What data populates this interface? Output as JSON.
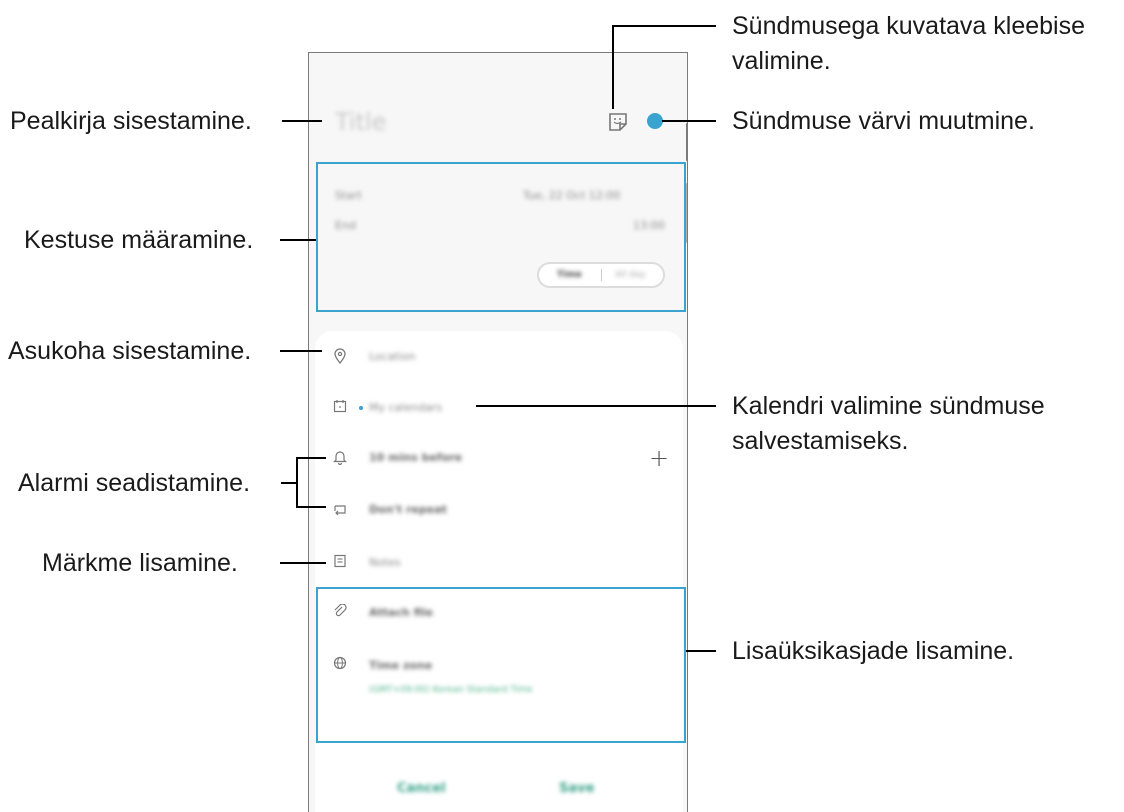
{
  "screen": {
    "title_placeholder": "Title",
    "start_label": "Start",
    "start_value": "Tue, 22 Oct  12:00",
    "end_label": "End",
    "end_value": "13:00",
    "toggle_time": "Time",
    "toggle_allday": "All day",
    "location": "Location",
    "calendar": "My calendars",
    "alarm": "10 mins before",
    "repeat": "Don't repeat",
    "notes": "Notes",
    "attach": "Attach file",
    "timezone": "Time zone",
    "timezone_value": "(GMT+09:00) Korean Standard Time",
    "cancel": "Cancel",
    "save": "Save",
    "event_color": "#3aa3d0"
  },
  "callouts": {
    "title": "Pealkirja sisestamine.",
    "duration": "Kestuse määramine.",
    "location": "Asukoha sisestamine.",
    "alarm": "Alarmi seadistamine.",
    "notes": "Märkme lisamine.",
    "sticker_line1": "Sündmusega kuvatava kleebise",
    "sticker_line2": "valimine.",
    "color": "Sündmuse värvi muutmine.",
    "calendar_line1": "Kalendri valimine sündmuse",
    "calendar_line2": "salvestamiseks.",
    "details": "Lisaüksikasjade lisamine."
  }
}
